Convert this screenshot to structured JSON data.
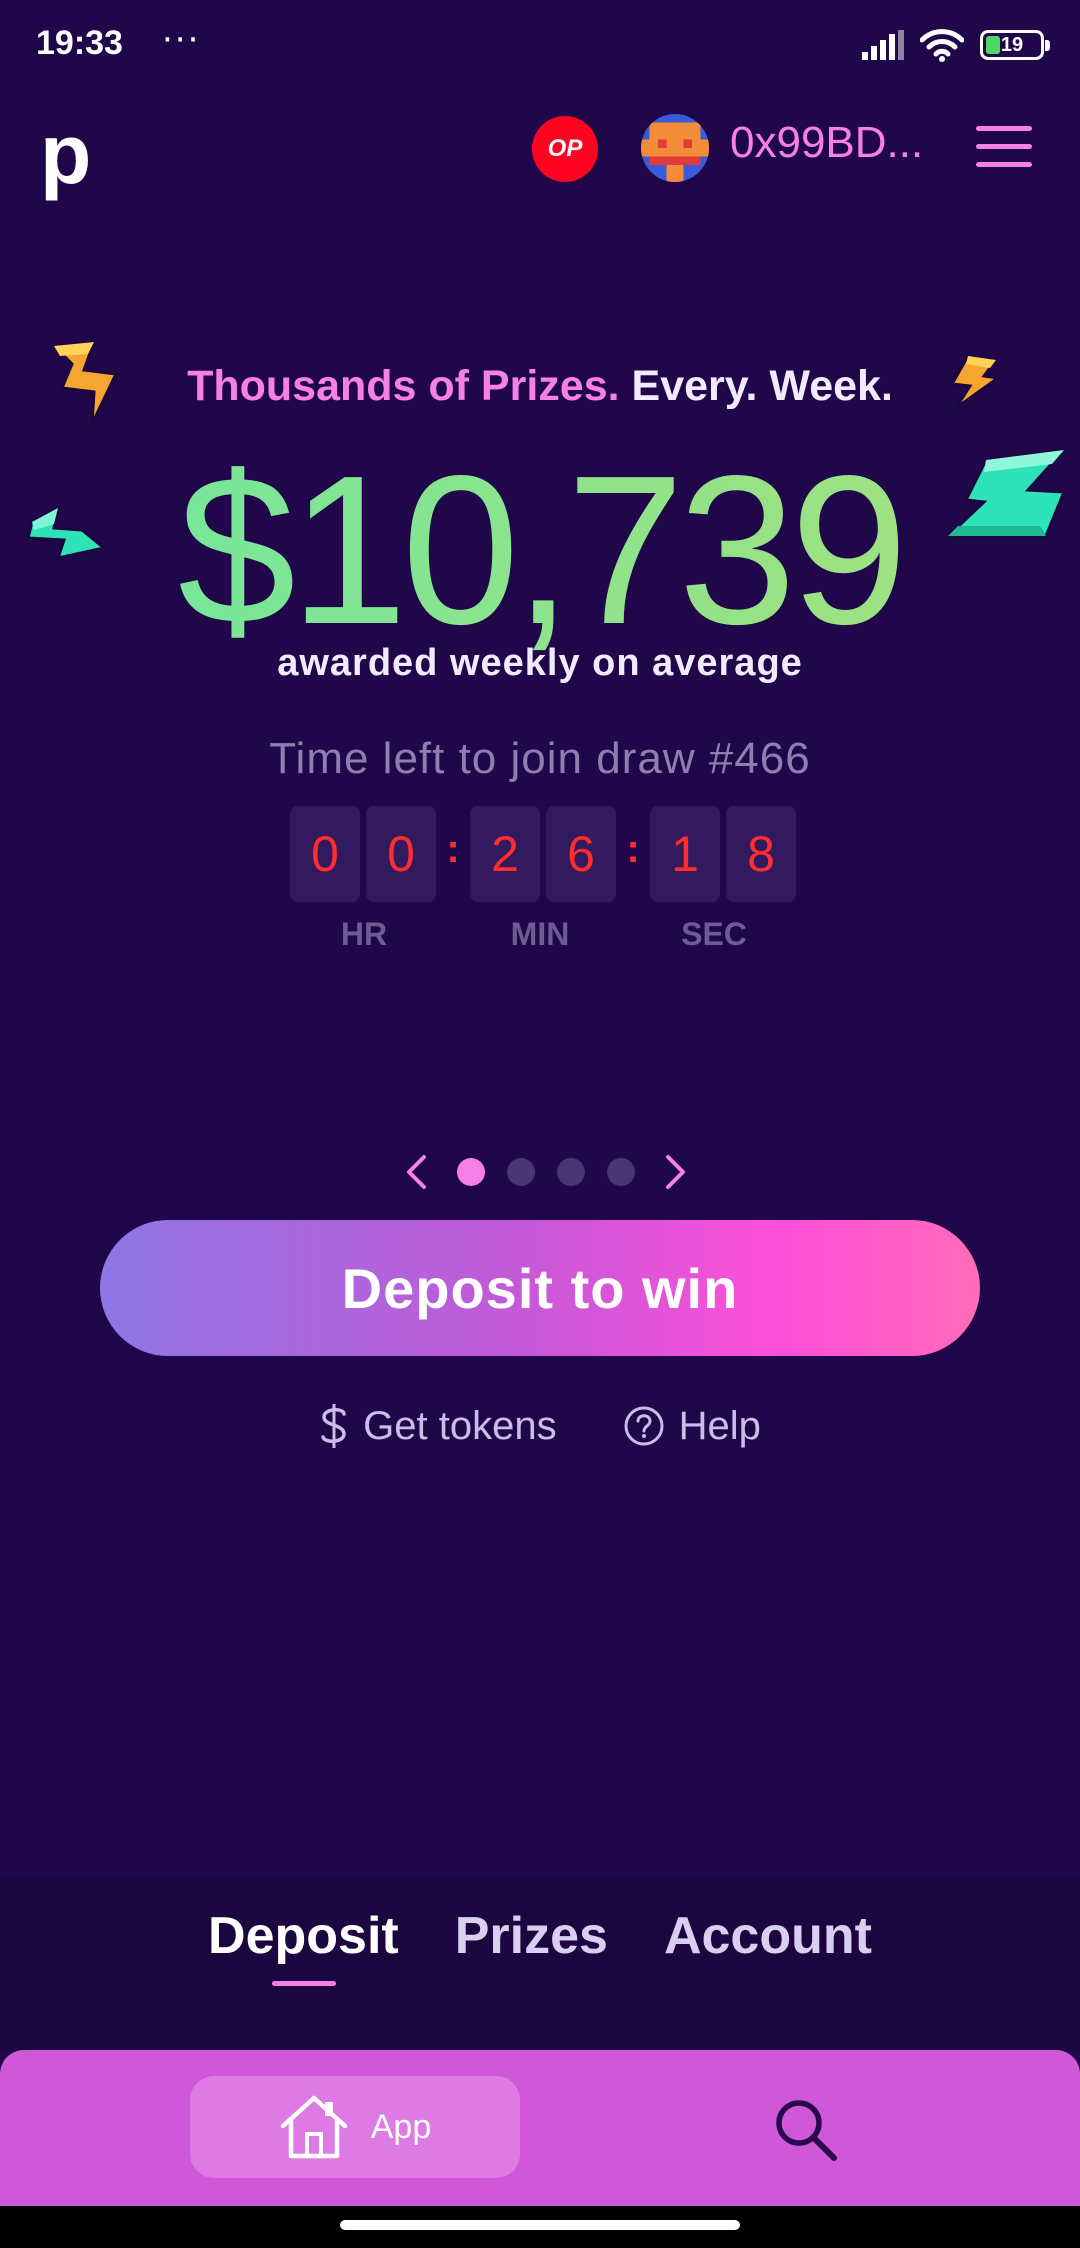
{
  "status_bar": {
    "time": "19:33",
    "dots": "···",
    "battery": "19"
  },
  "header": {
    "logo": "p",
    "network_badge": "OP",
    "wallet_address": "0x99BD..."
  },
  "hero": {
    "tagline_highlight": "Thousands of Prizes.",
    "tagline_rest": "Every. Week.",
    "amount": "$10,739",
    "amount_caption": "awarded weekly on average",
    "draw_label": "Time left to join draw #466"
  },
  "countdown": {
    "hr": [
      "0",
      "0"
    ],
    "min": [
      "2",
      "6"
    ],
    "sec": [
      "1",
      "8"
    ],
    "separator": ":",
    "units": {
      "hr": "HR",
      "min": "MIN",
      "sec": "SEC"
    }
  },
  "carousel": {
    "total": 4,
    "active_index": 0
  },
  "cta": {
    "deposit_label": "Deposit to win",
    "get_tokens_label": "Get tokens",
    "help_label": "Help"
  },
  "tabs": [
    {
      "label": "Deposit",
      "active": true
    },
    {
      "label": "Prizes",
      "active": false
    },
    {
      "label": "Account",
      "active": false
    }
  ],
  "browser": {
    "app_label": "App"
  },
  "colors": {
    "background": "#20074a",
    "accent_pink": "#f77fe8",
    "amount_green": "#8fe38a",
    "countdown_red": "#ff2d2d",
    "browser_bar": "#cf58d8"
  }
}
